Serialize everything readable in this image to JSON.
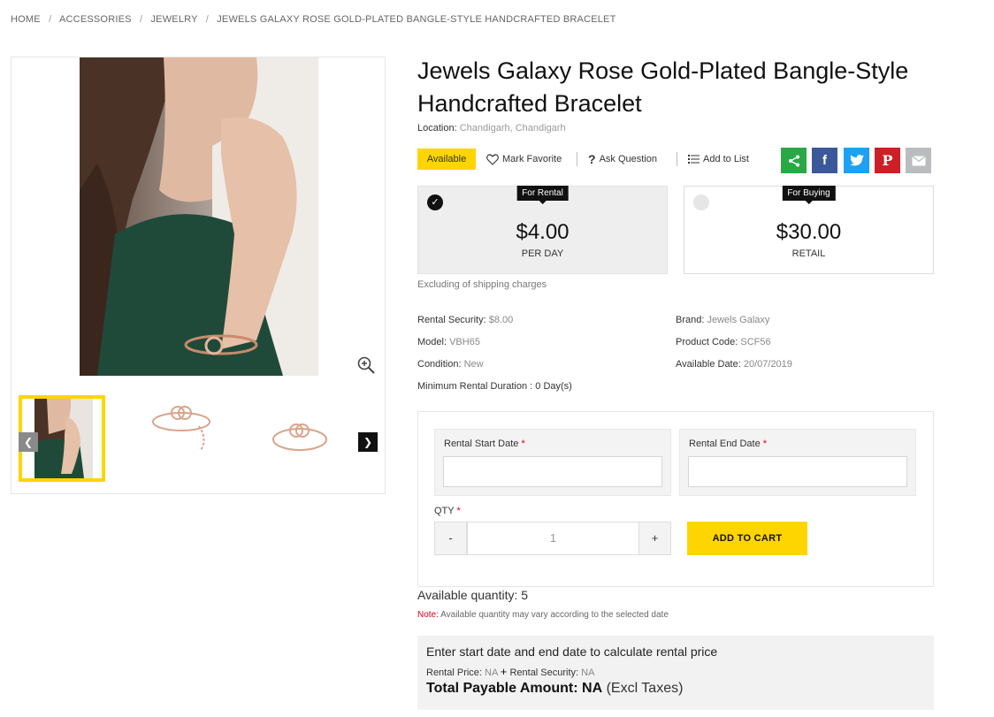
{
  "breadcrumb": {
    "home": "HOME",
    "accessories": "ACCESSORIES",
    "jewelry": "JEWELRY",
    "current": "JEWELS GALAXY ROSE GOLD-PLATED BANGLE-STYLE HANDCRAFTED BRACELET",
    "separator": "/"
  },
  "product": {
    "title": "Jewels Galaxy Rose Gold-Plated Bangle-Style Handcrafted Bracelet",
    "location_label": "Location:",
    "location_value": "Chandigarh, Chandigarh"
  },
  "actions": {
    "available": "Available",
    "mark_favorite": "Mark Favorite",
    "ask_question": "Ask Question",
    "add_to_list": "Add to List"
  },
  "social": {
    "share_color": "#2aa845",
    "facebook_color": "#3b5998",
    "twitter_color": "#1da1f2",
    "pinterest_color": "#cb2027",
    "email_color": "#b9bdbf"
  },
  "pricing": {
    "rental_tag": "For Rental",
    "rental_amount": "$4.00",
    "rental_unit": "PER DAY",
    "buying_tag": "For Buying",
    "buying_amount": "$30.00",
    "buying_unit": "RETAIL",
    "shipping_note": "Excluding of shipping charges"
  },
  "specs": {
    "rental_security_label": "Rental Security:",
    "rental_security_value": "$8.00",
    "model_label": "Model:",
    "model_value": "VBH65",
    "condition_label": "Condition:",
    "condition_value": "New",
    "min_duration_label": "Minimum Rental Duration :",
    "min_duration_value": "0 Day(s)",
    "brand_label": "Brand:",
    "brand_value": "Jewels Galaxy",
    "product_code_label": "Product Code:",
    "product_code_value": "SCF56",
    "available_date_label": "Available Date:",
    "available_date_value": "20/07/2019"
  },
  "booking": {
    "start_label": "Rental Start Date",
    "end_label": "Rental End Date",
    "required_mark": "*",
    "qty_label": "QTY",
    "qty_minus": "-",
    "qty_value": "1",
    "qty_plus": "+",
    "add_to_cart": "ADD TO CART"
  },
  "availability": {
    "quantity_text": "Available quantity: 5",
    "note_label": "Note:",
    "note_text": "Available quantity may vary according to the selected date"
  },
  "calculation": {
    "prompt": "Enter start date and end date to calculate rental price",
    "rental_price_label": "Rental Price:",
    "rental_price_value": "NA",
    "plus": "+",
    "rental_security_label": "Rental Security:",
    "rental_security_value": "NA",
    "total_label": "Total Payable Amount: NA",
    "total_suffix": "(Excl Taxes)"
  }
}
